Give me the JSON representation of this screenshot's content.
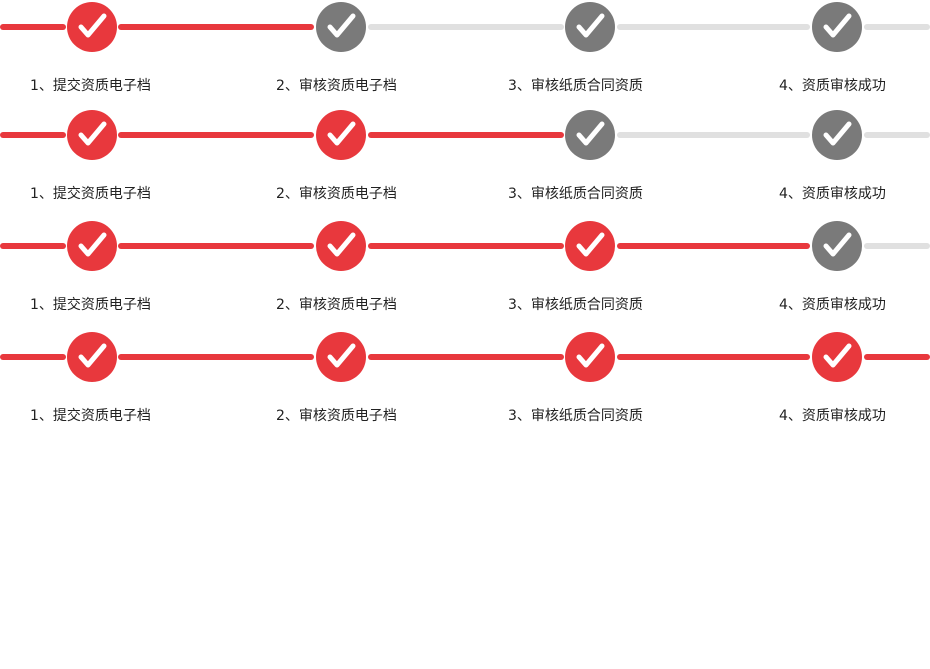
{
  "colors": {
    "complete": "#e8383d",
    "incomplete_node": "#7a7a7a",
    "incomplete_line": "#e0e0e0",
    "label_text": "#222222"
  },
  "icon": "check-icon",
  "steppers": [
    {
      "completed_steps": 1,
      "steps": [
        {
          "label": "1、提交资质电子档",
          "status": "done"
        },
        {
          "label": "2、审核资质电子档",
          "status": "pending"
        },
        {
          "label": "3、审核纸质合同资质",
          "status": "pending"
        },
        {
          "label": "4、资质审核成功",
          "status": "pending"
        }
      ]
    },
    {
      "completed_steps": 2,
      "steps": [
        {
          "label": "1、提交资质电子档",
          "status": "done"
        },
        {
          "label": "2、审核资质电子档",
          "status": "done"
        },
        {
          "label": "3、审核纸质合同资质",
          "status": "pending"
        },
        {
          "label": "4、资质审核成功",
          "status": "pending"
        }
      ]
    },
    {
      "completed_steps": 3,
      "steps": [
        {
          "label": "1、提交资质电子档",
          "status": "done"
        },
        {
          "label": "2、审核资质电子档",
          "status": "done"
        },
        {
          "label": "3、审核纸质合同资质",
          "status": "done"
        },
        {
          "label": "4、资质审核成功",
          "status": "pending"
        }
      ]
    },
    {
      "completed_steps": 4,
      "steps": [
        {
          "label": "1、提交资质电子档",
          "status": "done"
        },
        {
          "label": "2、审核资质电子档",
          "status": "done"
        },
        {
          "label": "3、审核纸质合同资质",
          "status": "done"
        },
        {
          "label": "4、资质审核成功",
          "status": "done"
        }
      ]
    }
  ]
}
